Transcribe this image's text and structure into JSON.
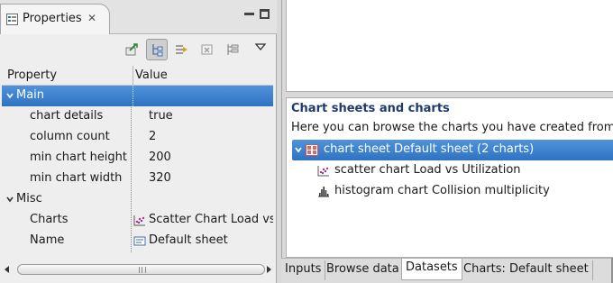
{
  "properties_view": {
    "tab_label": "Properties",
    "close_glyph": "✕",
    "columns": {
      "property": "Property",
      "value": "Value"
    },
    "rows": [
      {
        "kind": "category",
        "key": "Main",
        "value": "",
        "expanded": true,
        "selected": true
      },
      {
        "kind": "leaf",
        "key": "chart details",
        "value": "true"
      },
      {
        "kind": "leaf",
        "key": "column count",
        "value": "2"
      },
      {
        "kind": "leaf",
        "key": "min chart height",
        "value": "200"
      },
      {
        "kind": "leaf",
        "key": "min chart width",
        "value": "320"
      },
      {
        "kind": "category",
        "key": "Misc",
        "value": "",
        "expanded": true
      },
      {
        "kind": "leaf",
        "key": "Charts",
        "value": "Scatter Chart Load vs Utilization",
        "icon": "scatter-chart-icon"
      },
      {
        "kind": "leaf",
        "key": "Name",
        "value": "Default sheet",
        "icon": "name-field-icon"
      }
    ],
    "toolbar_icons": [
      "pin-icon",
      "categories-icon",
      "filter-advanced-icon",
      "restore-default-icon",
      "tree-layout-icon",
      "view-menu-icon"
    ]
  },
  "editor": {
    "section_title": "Chart sheets and charts",
    "section_description": "Here you can browse the charts you have created from the",
    "tree": [
      {
        "label": "chart sheet Default sheet (2 charts)",
        "icon": "chart-sheet-icon",
        "level": 0,
        "selected": true,
        "expanded": true
      },
      {
        "label": "scatter chart Load vs Utilization",
        "icon": "scatter-chart-icon",
        "level": 1
      },
      {
        "label": "histogram chart Collision multiplicity",
        "icon": "histogram-chart-icon",
        "level": 1
      }
    ],
    "bottom_tabs": [
      {
        "label": "Inputs",
        "active": false
      },
      {
        "label": "Browse data",
        "active": false
      },
      {
        "label": "Datasets",
        "active": true
      },
      {
        "label": "Charts: Default sheet",
        "active": false
      }
    ]
  },
  "colors": {
    "selection": "#3a7fd0",
    "section_title": "#1d3b6b",
    "view_background": "#eeeeee"
  }
}
